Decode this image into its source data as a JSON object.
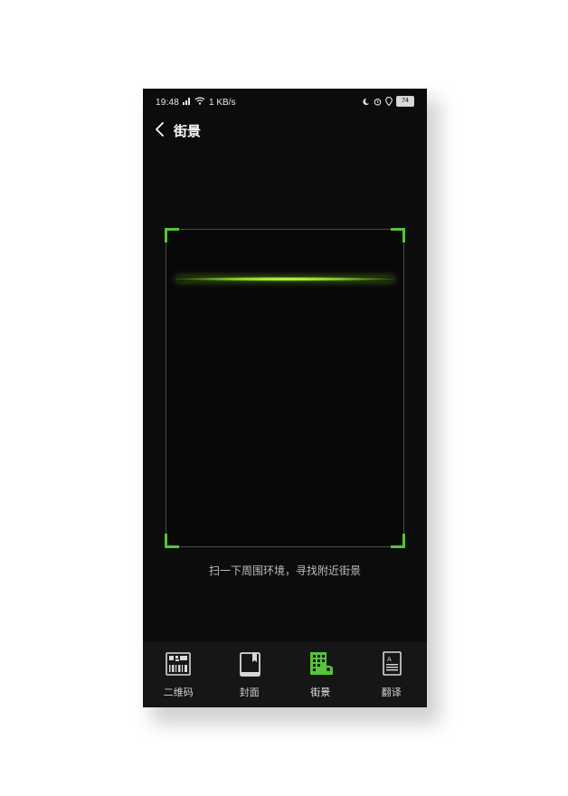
{
  "status_bar": {
    "time": "19:48",
    "network_speed": "1 KB/s",
    "battery": "74"
  },
  "header": {
    "title": "街景",
    "back_icon": "chevron-left-icon"
  },
  "scanner": {
    "hint": "扫一下周围环境，寻找附近街景",
    "accent_color": "#55c43a"
  },
  "tab_bar": {
    "tabs": [
      {
        "label": "二维码",
        "icon": "qr-barcode-icon"
      },
      {
        "label": "封面",
        "icon": "book-cover-icon"
      },
      {
        "label": "街景",
        "icon": "street-building-icon",
        "active": true
      },
      {
        "label": "翻译",
        "icon": "translate-document-icon"
      }
    ]
  }
}
